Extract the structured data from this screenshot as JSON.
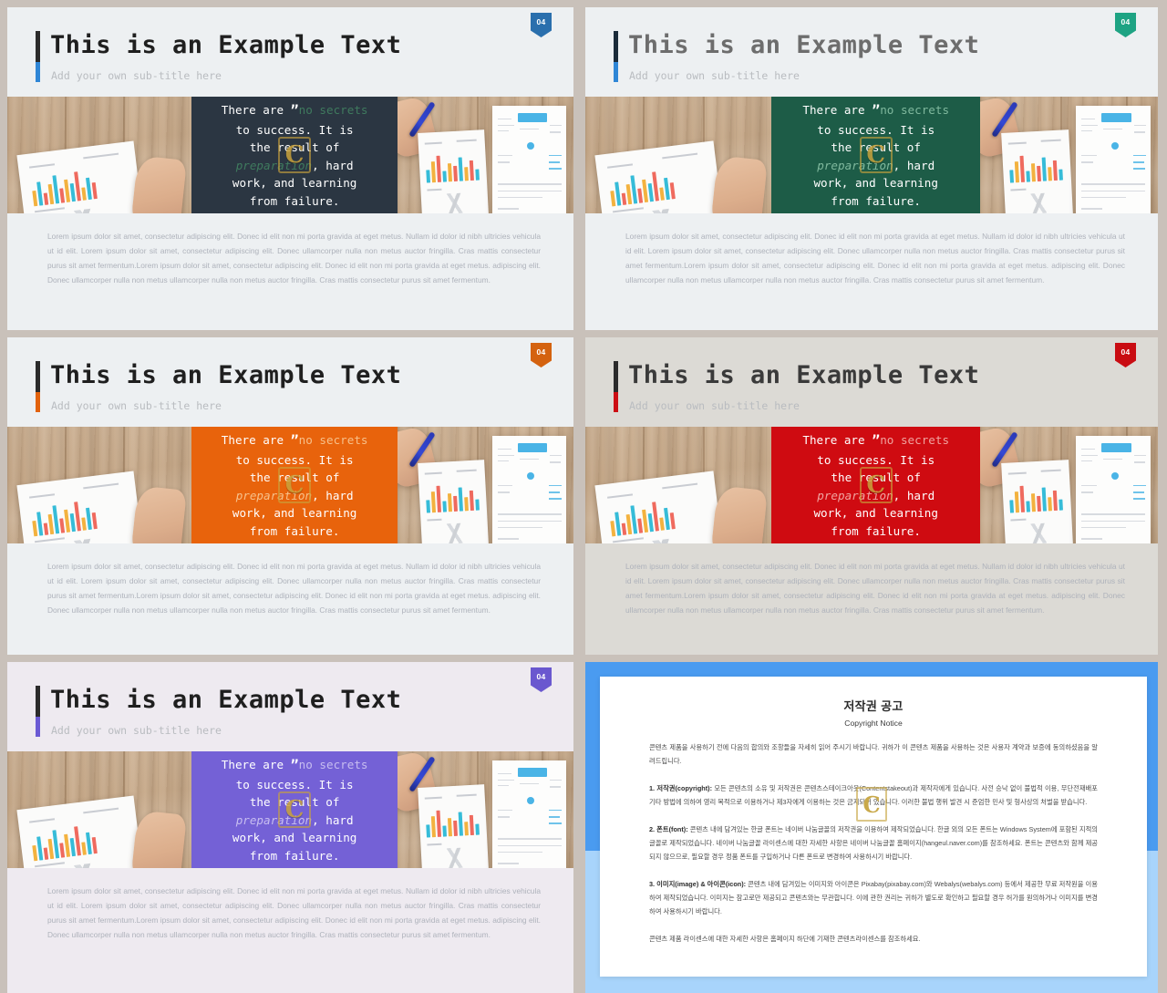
{
  "deck": {
    "slide_number_badge": "04",
    "title": "This is an Example Text",
    "subtitle": "Add your own sub-title here",
    "quote": {
      "line1_a": "There are",
      "quote_mark": "”",
      "line1_b": "no secrets",
      "line2": "to success. It is",
      "line3": "the result of",
      "line4_a": "preparation",
      "line4_b": ", hard",
      "line5": "work, and learning",
      "line6": "from failure."
    },
    "body_text": "Lorem ipsum dolor sit amet, consectetur adipiscing elit. Donec id elit non mi porta gravida at eget metus. Nullam id dolor id nibh ultricies vehicula ut id elit. Lorem ipsum dolor sit amet, consectetur adipiscing elit. Donec ullamcorper nulla non metus auctor fringilla. Cras mattis consectetur purus sit amet fermentum.Lorem ipsum dolor sit amet, consectetur adipiscing elit. Donec id elit non mi porta gravida at eget metus. adipiscing elit. Donec ullamcorper nulla non metus ullamcorper nulla non metus auctor fringilla. Cras mattis consectetur purus sit amet fermentum.",
    "watermark_letter": "C"
  },
  "slides": [
    {
      "id": "slide-navy",
      "variant_name": "navy",
      "accent_color": "#2e3e50",
      "badge_color": "#2a6fad",
      "quote_bg": "#2b3642",
      "quote_accent": "#3f7a5e",
      "header_bg": "#edf0f2",
      "title_color": "#1f1f1f",
      "bar_color": "#2f86d6"
    },
    {
      "id": "slide-teal",
      "variant_name": "teal",
      "accent_color": "#1f6b55",
      "badge_color": "#1ea383",
      "quote_bg": "#1d5c47",
      "quote_accent": "#7fb89d",
      "header_bg": "#edf0f2",
      "title_color": "#6d6d6d",
      "bar_color": "#2f86d6"
    },
    {
      "id": "slide-orange",
      "variant_name": "orange",
      "accent_color": "#e2620d",
      "badge_color": "#d4620f",
      "quote_bg": "#e8630c",
      "quote_accent": "#f7c08a",
      "header_bg": "#edf0f2",
      "title_color": "#1f1f1f",
      "bar_color": "#e2620d"
    },
    {
      "id": "slide-red",
      "variant_name": "red",
      "accent_color": "#cc0d13",
      "badge_color": "#c90c12",
      "quote_bg": "#cf0b11",
      "quote_accent": "#f0a39f",
      "header_bg": "#dcdad5",
      "title_color": "#3a3a3a",
      "bar_color": "#cc0d13"
    },
    {
      "id": "slide-purple",
      "variant_name": "purple",
      "accent_color": "#6b5ad4",
      "badge_color": "#6a58cf",
      "quote_bg": "#7461d6",
      "quote_accent": "#c7bdf0",
      "header_bg": "#eeeaf0",
      "title_color": "#1f1f1f",
      "bar_color": "#6b5ad4"
    }
  ],
  "copyright_slide": {
    "id": "slide-copyright",
    "border_color": "#4a9bf0",
    "lower_border_color": "#a8d4fb",
    "title_ko": "저작권 공고",
    "title_en": "Copyright Notice",
    "intro": "콘텐츠 제품을 사용하기 전에 다음의 합의와 조항들을 자세히 읽어 주시기 바랍니다. 귀하가 이 콘텐츠 제품을 사용하는 것은 사용자 계약과 보증에 동의하셨음을 알려드립니다.",
    "item1_label": "1. 저작권(copyright):",
    "item1_text": " 모든 콘텐츠의 소유 및 저작권은 콘텐츠스테이크아웃(Contentstakeout)과 제작자에게 있습니다. 사전 승낙 없이 불법적 이용, 무단전재배포 기타 방법에 의하여 영리 목적으로 이용하거나 제3자에게 이용하는 것은 금지되어 있습니다. 이러한 불법 행위 발견 시 준엄한 민사 및 형사상의 처벌을 받습니다.",
    "item2_label": "2. 폰트(font):",
    "item2_text": " 콘텐츠 내에 담겨있는 한글 폰트는 네이버 나눔글꼴의 저작권을 이용하여 제작되었습니다. 한글 외의 모든 폰트는 Windows System에 포함된 지적의 글꼴로 제작되었습니다. 네이버 나눔글꼴 라이센스에 대한 자세한 사항은 네이버 나눔글꼴 홈페이지(hangeul.naver.com)를 참조하세요. 폰트는 콘텐츠와 함께 제공되지 않으므로, 필요할 경우 정품 폰트를 구입하거나 다른 폰트로 변경하여 사용하시기 바랍니다.",
    "item3_label": "3. 이미지(image) & 아이콘(icon):",
    "item3_text": " 콘텐츠 내에 담겨있는 이미지와 아이콘은 Pixabay(pixabay.com)와 Webalys(webalys.com) 등에서 제공한 무료 저작원을 이용하여 제작되었습니다. 이미지는 참고로만 제공되고 콘텐츠와는 무관합니다. 이에 관한 권리는 귀하가 별도로 확인하고 필요할 경우 허가를 원의하거나 이미지를 변경하여 사용하시기 바랍니다.",
    "outro": "콘텐츠 제품 라이센스에 대한 자세한 사항은 홈페이지 하단에 기재한 콘텐츠라이센스를 참조하세요.",
    "watermark_letter": "C"
  }
}
